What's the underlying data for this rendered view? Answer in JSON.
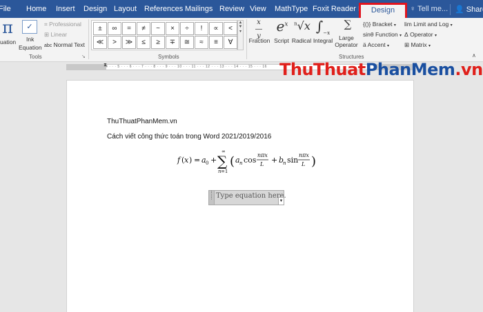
{
  "tabs": [
    "File",
    "Home",
    "Insert",
    "Design",
    "Layout",
    "References",
    "Mailings",
    "Review",
    "View",
    "MathType",
    "Foxit Reader PDF",
    "Design"
  ],
  "tell_me": "Tell me...",
  "share": "Share",
  "ribbon": {
    "tools": {
      "equation_label": "uation",
      "ink_equation_line1": "Ink",
      "ink_equation_line2": "Equation",
      "professional": "Professional",
      "linear": "Linear",
      "normal_text": "Normal Text",
      "group_label": "Tools"
    },
    "symbols": {
      "row1": [
        "±",
        "∞",
        "=",
        "≠",
        "~",
        "×",
        "÷",
        "!",
        "∝",
        "<"
      ],
      "row2": [
        "≪",
        ">",
        "≫",
        "≤",
        "≥",
        "∓",
        "≅",
        "≈",
        "≡",
        "∀"
      ],
      "group_label": "Symbols"
    },
    "structures": {
      "fraction": "Fraction",
      "script": "Script",
      "radical": "Radical",
      "integral": "Integral",
      "large_operator_line1": "Large",
      "large_operator_line2": "Operator",
      "bracket": "Bracket",
      "function": "Function",
      "accent": "Accent",
      "limit_and_log": "Limit and Log",
      "operator": "Operator",
      "matrix": "Matrix",
      "group_label": "Structures"
    }
  },
  "watermark": {
    "part1": "ThuThuat",
    "part2": "PhanMem",
    "part3": ".vn"
  },
  "document": {
    "line1": "ThuThuatPhanMem.vn",
    "line2": "Cách viết công thức toán trong Word 2021/2019/2016",
    "equation_placeholder": "Type equation here."
  },
  "colors": {
    "title_bar": "#2b579a",
    "highlight_border": "#e0141e",
    "watermark_red": "#e0201b",
    "watermark_blue": "#1a4fa0"
  }
}
